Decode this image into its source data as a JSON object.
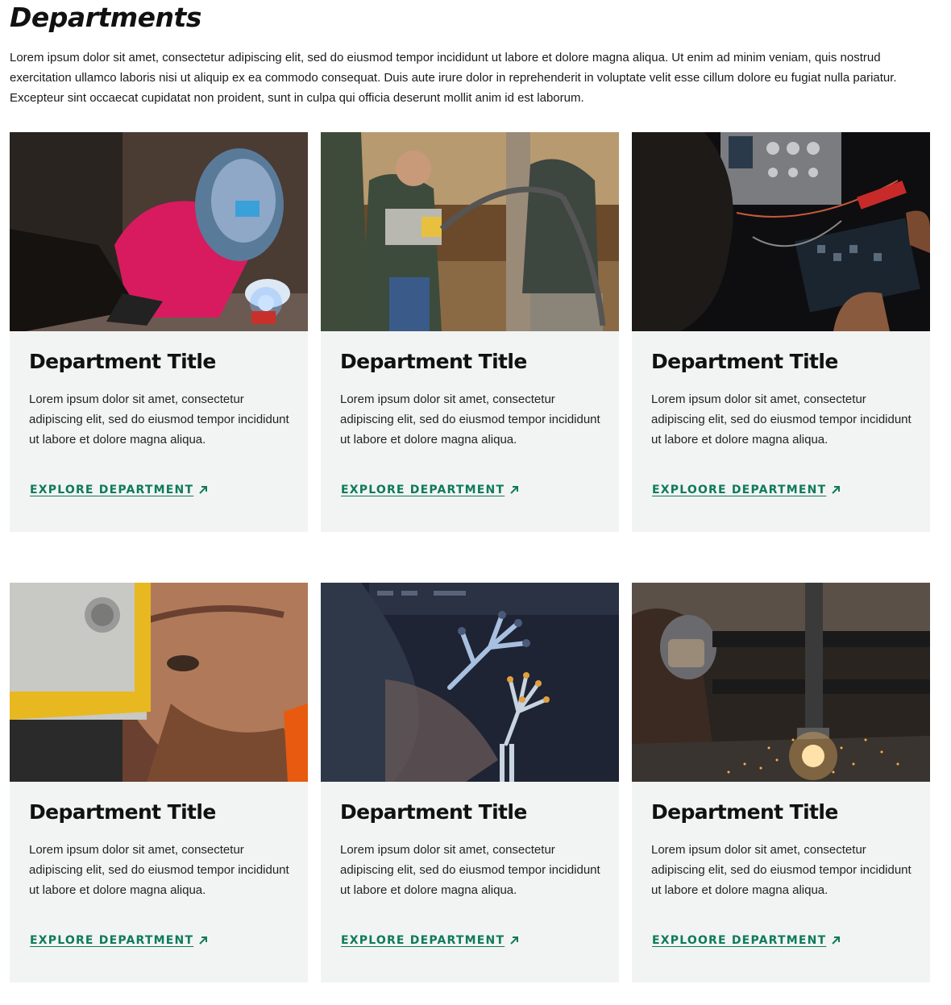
{
  "page": {
    "title": "Departments",
    "intro": "Lorem ipsum dolor sit amet, consectetur adipiscing elit, sed do eiusmod tempor incididunt ut labore et dolore magna aliqua. Ut enim ad minim veniam, quis nostrud exercitation ullamco laboris nisi ut aliquip ex ea commodo consequat. Duis aute irure dolor in reprehenderit in voluptate velit esse cillum dolore eu fugiat nulla pariatur. Excepteur sint occaecat cupidatat non proident, sunt in culpa qui officia deserunt mollit anim id est laborum."
  },
  "accent_color": "#0f7a5a",
  "cards": [
    {
      "title": "Department Title",
      "description": "Lorem ipsum dolor sit amet, consectetur adipiscing elit, sed do eiusmod tempor incididunt ut labore et dolore magna aliqua.",
      "link": "EXPLORE DEPARTMENT",
      "icon": "arrow-up-right-icon"
    },
    {
      "title": "Department Title",
      "description": "Lorem ipsum dolor sit amet, consectetur adipiscing elit, sed do eiusmod tempor incididunt ut labore et dolore magna aliqua.",
      "link": "EXPLORE DEPARTMENT",
      "icon": "arrow-up-right-icon"
    },
    {
      "title": "Department Title",
      "description": "Lorem ipsum dolor sit amet, consectetur adipiscing elit, sed do eiusmod tempor incididunt ut labore et dolore magna aliqua.",
      "link": "EXPLOORE DEPARTMENT",
      "icon": "arrow-up-right-icon"
    },
    {
      "title": "Department Title",
      "description": "Lorem ipsum dolor sit amet, consectetur adipiscing elit, sed do eiusmod tempor incididunt ut labore et dolore magna aliqua.",
      "link": "EXPLORE DEPARTMENT",
      "icon": "arrow-up-right-icon"
    },
    {
      "title": "Department Title",
      "description": "Lorem ipsum dolor sit amet, consectetur adipiscing elit, sed do eiusmod tempor incididunt ut labore et dolore magna aliqua.",
      "link": "EXPLORE DEPARTMENT",
      "icon": "arrow-up-right-icon"
    },
    {
      "title": "Department Title",
      "description": "Lorem ipsum dolor sit amet, consectetur adipiscing elit, sed do eiusmod tempor incididunt ut labore et dolore magna aliqua.",
      "link": "EXPLOORE DEPARTMENT",
      "icon": "arrow-up-right-icon"
    }
  ]
}
